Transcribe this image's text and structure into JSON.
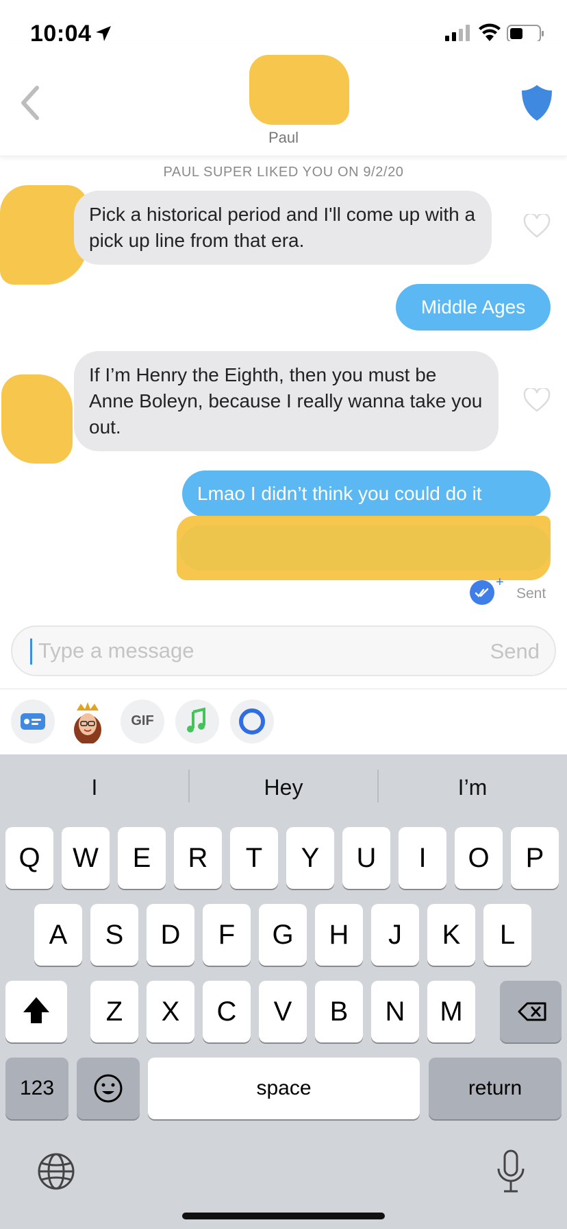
{
  "status_bar": {
    "time": "10:04"
  },
  "header": {
    "contact_name": "Paul"
  },
  "chat": {
    "date_separator": "PAUL SUPER LIKED YOU ON 9/2/20",
    "messages": [
      {
        "from": "them",
        "text": "Pick a historical period and I'll come up with a pick up line from that era."
      },
      {
        "from": "me",
        "text": "Middle Ages"
      },
      {
        "from": "them",
        "text": "If I’m Henry the Eighth, then you must be Anne Boleyn, because I really wanna take you out."
      },
      {
        "from": "me",
        "text": "Lmao I didn’t think you could do it"
      },
      {
        "from": "me",
        "text": ""
      }
    ],
    "sent_status": "Sent"
  },
  "input": {
    "placeholder": "Type a message",
    "send_label": "Send"
  },
  "attachments": {
    "gif_label": "GIF"
  },
  "keyboard": {
    "suggestions": [
      "I",
      "Hey",
      "I’m"
    ],
    "row1": [
      "Q",
      "W",
      "E",
      "R",
      "T",
      "Y",
      "U",
      "I",
      "O",
      "P"
    ],
    "row2": [
      "A",
      "S",
      "D",
      "F",
      "G",
      "H",
      "J",
      "K",
      "L"
    ],
    "row3": [
      "Z",
      "X",
      "C",
      "V",
      "B",
      "N",
      "M"
    ],
    "numbers_label": "123",
    "space_label": "space",
    "return_label": "return"
  },
  "colors": {
    "accent_blue": "#5bb8f2",
    "incoming_bubble": "#e8e8ea",
    "redaction_yellow": "#f5c442",
    "shield_blue": "#3f8ae0"
  }
}
